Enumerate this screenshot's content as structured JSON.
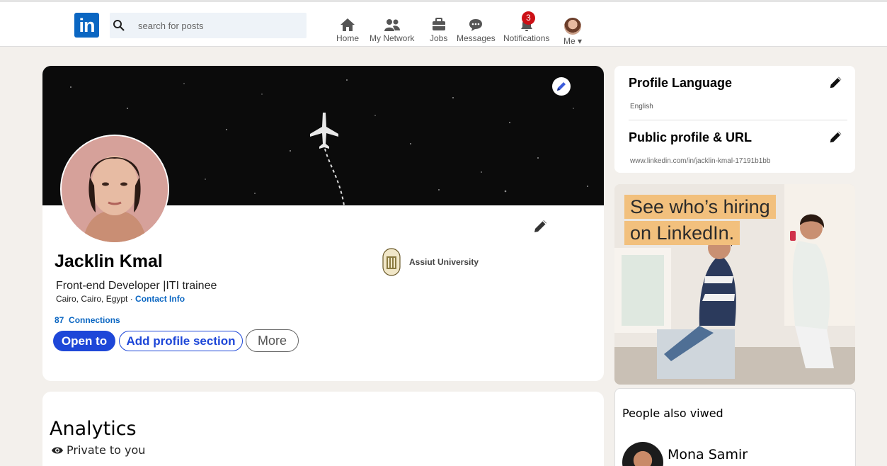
{
  "nav": {
    "logo": "in",
    "search_placeholder": "search for posts",
    "items": [
      {
        "label": "Home",
        "icon": "home-icon"
      },
      {
        "label": "My Network",
        "icon": "network-icon"
      },
      {
        "label": "Jobs",
        "icon": "briefcase-icon"
      },
      {
        "label": "Messages",
        "icon": "messages-icon"
      },
      {
        "label": "Notifications",
        "icon": "bell-icon",
        "badge": "3"
      },
      {
        "label": "Me",
        "icon": "avatar"
      }
    ],
    "badge_color": "#cc1016"
  },
  "profile": {
    "name": "Jacklin Kmal",
    "headline": "Front-end Developer |ITI trainee",
    "location": "Cairo, Cairo, Egypt ·",
    "contact_info": "Contact Info",
    "connections_count": "87",
    "connections_label": "Connections",
    "school": "Assiut University",
    "buttons": {
      "open_to": "Open to",
      "add_section": "Add profile section",
      "more": "More"
    }
  },
  "analytics": {
    "title": "Analytics",
    "subtitle": "Private to you"
  },
  "sidebar": {
    "profile_language": {
      "title": "Profile Language",
      "value": "English"
    },
    "public_profile": {
      "title": "Public profile & URL",
      "value": "www.linkedin.com/in/jacklin-kmal-17191b1bb"
    }
  },
  "ad": {
    "line1": "See who’s hiring",
    "line2": "on LinkedIn."
  },
  "people": {
    "title": "People also viwed",
    "items": [
      {
        "name": "Mona Samir"
      }
    ]
  },
  "colors": {
    "accent": "#1e47d8",
    "link": "#0a66c2",
    "background": "#f3f0ec"
  }
}
